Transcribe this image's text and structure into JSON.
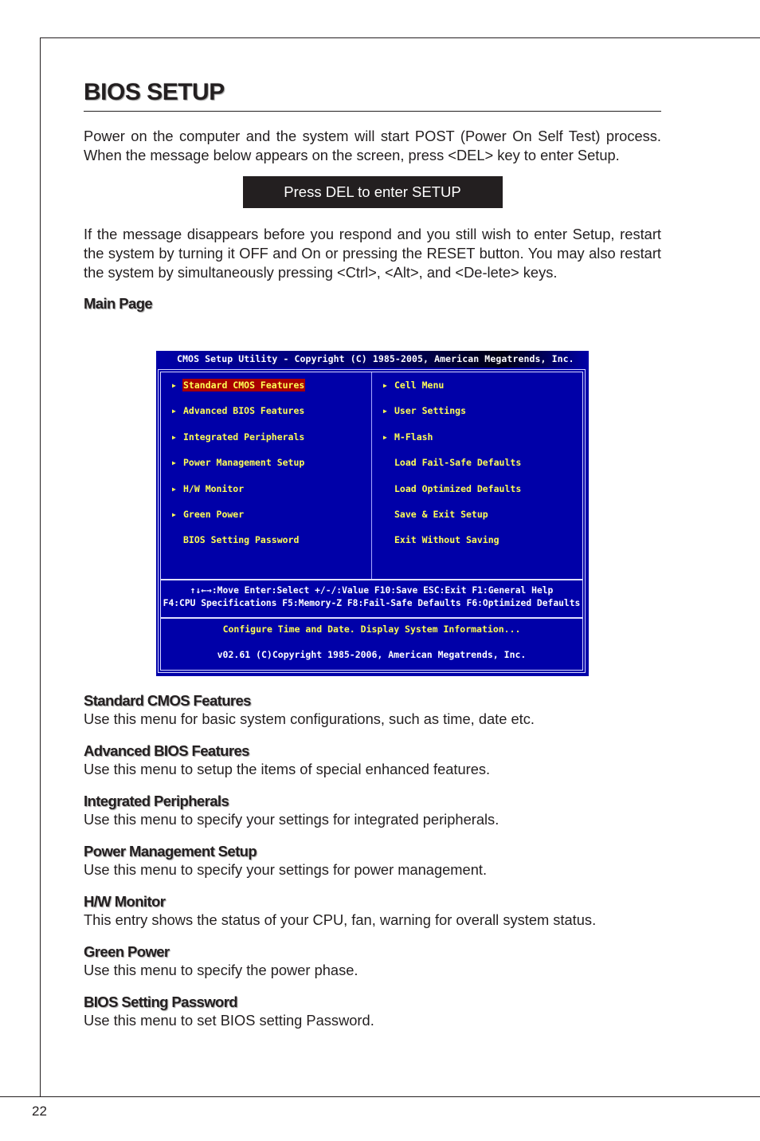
{
  "page": {
    "title": "BIOS SETUP",
    "intro": "Power on the computer and the system will start POST (Power On Self Test) process. When the message below appears on the screen, press <DEL> key to enter Setup.",
    "del_message": "Press DEL to enter SETUP",
    "restart_note": "If the message disappears before you respond and you still wish to enter Setup, restart the system by turning it OFF and On or pressing the RESET button. You may also restart the system by simultaneously pressing <Ctrl>, <Alt>, and <De-lete> keys.",
    "main_page_label": "Main Page",
    "page_number": "22"
  },
  "bios": {
    "title_bar": "CMOS Setup Utility - Copyright (C) 1985-2005, American Megatrends, Inc.",
    "colors": {
      "background": "#0000a8",
      "item_text": "#ffff55",
      "selected_bg": "#a80000",
      "info_text": "#ffffff"
    },
    "left_menu": [
      {
        "label": "Standard CMOS Features",
        "arrow": "▶",
        "selected": true
      },
      {
        "label": "Advanced BIOS Features",
        "arrow": "▶"
      },
      {
        "label": "Integrated Peripherals",
        "arrow": "▶"
      },
      {
        "label": "Power Management Setup",
        "arrow": "▶"
      },
      {
        "label": "H/W Monitor",
        "arrow": "▶"
      },
      {
        "label": "Green Power",
        "arrow": "▶"
      },
      {
        "label": "BIOS Setting Password",
        "arrow": ""
      }
    ],
    "right_menu": [
      {
        "label": "Cell Menu",
        "arrow": "▶"
      },
      {
        "label": "User Settings",
        "arrow": "▶"
      },
      {
        "label": "M-Flash",
        "arrow": "▶"
      },
      {
        "label": "Load Fail-Safe Defaults",
        "arrow": ""
      },
      {
        "label": "Load Optimized Defaults",
        "arrow": ""
      },
      {
        "label": "Save & Exit Setup",
        "arrow": ""
      },
      {
        "label": "Exit Without Saving",
        "arrow": ""
      }
    ],
    "key_help_line1": "↑↓←→:Move  Enter:Select  +/-/:Value  F10:Save  ESC:Exit  F1:General Help",
    "key_help_line2": "F4:CPU Specifications F5:Memory-Z F8:Fail-Safe Defaults F6:Optimized Defaults",
    "status_line": "Configure Time and Date.  Display System Information...",
    "version_line": "v02.61 (C)Copyright 1985-2006, American Megatrends, Inc."
  },
  "descriptions": [
    {
      "title": "Standard CMOS Features",
      "text": "Use this menu for basic system configurations, such as time, date etc."
    },
    {
      "title": "Advanced BIOS Features",
      "text": "Use this menu to setup the items of special enhanced features."
    },
    {
      "title": "Integrated Peripherals",
      "text": "Use this menu to specify your settings for integrated peripherals."
    },
    {
      "title": "Power Management Setup",
      "text": "Use this menu to specify your settings for power management."
    },
    {
      "title": "H/W Monitor",
      "text": "This entry shows the status of your CPU, fan, warning for overall system status."
    },
    {
      "title": "Green Power",
      "text": "Use this menu to specify the power phase."
    },
    {
      "title": "BIOS Setting Password",
      "text": "Use this menu to set BIOS setting Password."
    }
  ]
}
